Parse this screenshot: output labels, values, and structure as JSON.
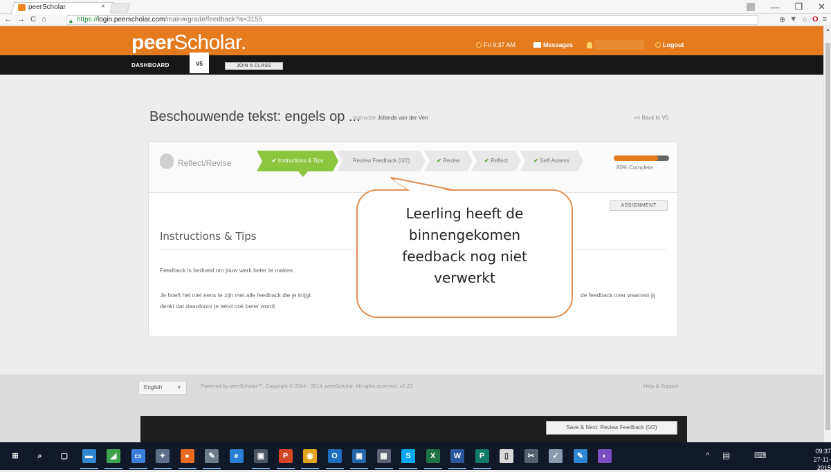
{
  "browser": {
    "tab_title": "peerScholar",
    "tab_close": "×",
    "url_scheme": "https://",
    "url_host": "login.peerscholar.com",
    "url_path": "/main#/grade/feedback?a=3155",
    "nav": {
      "back": "←",
      "forward": "→",
      "reload": "C",
      "home": "⌂"
    },
    "tools": {
      "zoom": "⊕",
      "filter": "▼",
      "star": "☆",
      "opera": "O",
      "menu": "≡"
    },
    "window": {
      "minimize": "—",
      "restore": "❐",
      "close": "✕"
    }
  },
  "header": {
    "logo_bold": "peer",
    "logo_rest": "Scholar.",
    "time": "Fri 9:37 AM",
    "messages": "Messages",
    "logout": "Logout"
  },
  "nav": {
    "dashboard": "DASHBOARD",
    "current": "V5",
    "join": "JOIN A CLASS"
  },
  "main": {
    "title": "Beschouwende tekst: engels op ...",
    "instructor_label": "Instructor",
    "instructor_name": "Jolanda van der Ven",
    "back_link": "<< Back to V5"
  },
  "steps": {
    "module": "Reflect/Revise",
    "items": [
      {
        "label": "Instructions & Tips",
        "done": true,
        "active": true
      },
      {
        "label": "Review Feedback (0/2)",
        "done": false,
        "active": false
      },
      {
        "label": "Revise",
        "done": true,
        "active": false
      },
      {
        "label": "Reflect",
        "done": true,
        "active": false
      },
      {
        "label": "Self-Assess",
        "done": true,
        "active": false
      }
    ],
    "check": "✔",
    "progress_percent": 80,
    "progress_label": "80% Complete"
  },
  "content": {
    "assignment_button": "ASSIGNMENT",
    "section_title": "Instructions & Tips",
    "para1": "Feedback is bedoeld om jouw werk beter te maken.",
    "para2_start": "Je hoeft het niet eens te zijn met alle feedback die je krijgt.",
    "para2_end": "de feedback over waarvan jij",
    "para3": "denkt dat daardooor je tekst ook beter wordt."
  },
  "callout": {
    "lines": [
      "Leerling heeft de",
      "binnengekomen",
      "feedback nog niet",
      "verwerkt"
    ],
    "border_color": "#e09055"
  },
  "footer": {
    "language": "English",
    "language_arrow": "▾",
    "powered": "Powered by peerScholar™. Copyright © 2004 - 2014, peerScholar. All rights reserved. v2.23",
    "help": "Help & Support",
    "save_next": "Save & Next: Review Feedback (0/2)"
  },
  "taskbar": {
    "time": "09:37",
    "date": "27-11-2015",
    "apps": [
      {
        "name": "start",
        "glyph": "⊞",
        "color": "#111827"
      },
      {
        "name": "search",
        "glyph": "⌕",
        "color": "#111827"
      },
      {
        "name": "task-view",
        "glyph": "▢",
        "color": "#111827"
      },
      {
        "name": "file-explorer",
        "glyph": "▬",
        "color": "#2f86d1"
      },
      {
        "name": "paint",
        "glyph": "◢",
        "color": "#3fa34d"
      },
      {
        "name": "computer",
        "glyph": "▭",
        "color": "#3b7dd8"
      },
      {
        "name": "network",
        "glyph": "✦",
        "color": "#5d6d8a"
      },
      {
        "name": "firefox",
        "glyph": "●",
        "color": "#e86c1f"
      },
      {
        "name": "tool",
        "glyph": "✎",
        "color": "#6d7b8c"
      },
      {
        "name": "edge",
        "glyph": "e",
        "color": "#2a7fd4"
      },
      {
        "name": "store",
        "glyph": "▣",
        "color": "#4b5563"
      },
      {
        "name": "powerpoint",
        "glyph": "P",
        "color": "#d24726"
      },
      {
        "name": "chrome",
        "glyph": "◉",
        "color": "#e0a31a"
      },
      {
        "name": "outlook",
        "glyph": "O",
        "color": "#1f6fc1"
      },
      {
        "name": "app-blue",
        "glyph": "▣",
        "color": "#2563a8"
      },
      {
        "name": "calculator",
        "glyph": "▦",
        "color": "#5b6470"
      },
      {
        "name": "skype",
        "glyph": "S",
        "color": "#00a9f0"
      },
      {
        "name": "excel",
        "glyph": "X",
        "color": "#1f7244"
      },
      {
        "name": "word",
        "glyph": "W",
        "color": "#2b579a"
      },
      {
        "name": "publisher",
        "glyph": "P",
        "color": "#0f7a6a"
      },
      {
        "name": "notepad",
        "glyph": "▯",
        "color": "#d9d9d9"
      },
      {
        "name": "app-tool",
        "glyph": "✂",
        "color": "#556070"
      },
      {
        "name": "app-check",
        "glyph": "✓",
        "color": "#8a9bb0"
      },
      {
        "name": "app-edit",
        "glyph": "✎",
        "color": "#2f86d1"
      },
      {
        "name": "app-purple",
        "glyph": "◐",
        "color": "#7b4cc2"
      }
    ]
  }
}
